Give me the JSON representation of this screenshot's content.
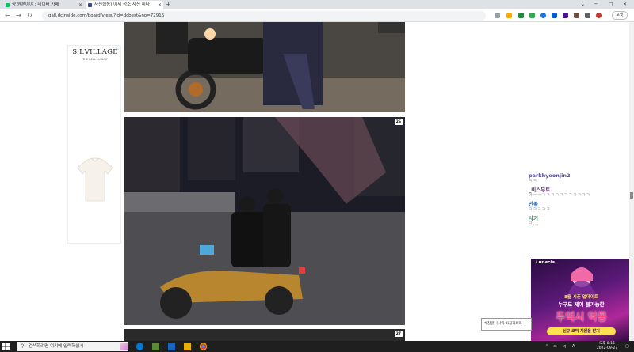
{
  "tabs": [
    {
      "title": "향 원본이야 : 네이버 카페",
      "active": false
    },
    {
      "title": "사진협동) 어제 청소 사진 피타",
      "active": true
    }
  ],
  "window_controls": {
    "minimize": "─",
    "maximize": "□",
    "close": "✕"
  },
  "toolbar": {
    "url": "gall.dcinside.com/board/view/?id=dcbest&no=72916",
    "profile_label": "포맷"
  },
  "ad": {
    "brand": "S.I.VILLAGE",
    "tagline": "THE REAL LUXURY"
  },
  "photos": [
    {
      "number": ""
    },
    {
      "number": "26"
    },
    {
      "number": "27"
    }
  ],
  "comments": [
    {
      "user": "parkhyeonjin2",
      "text": "ㅋㅋ",
      "color": "#5b4a9e"
    },
    {
      "user": "_비스무트",
      "text": "아ㅡㅡㅋㅋㅋㅋㅋㅋㅋㅋㅋㅋㅋ",
      "color": "#6a2e8a"
    },
    {
      "user": "만콜",
      "text": "ㅋㅋㅋㅋㅋ",
      "color": "#2a6ab0"
    },
    {
      "user": "사키__",
      "text": "ㅋ...",
      "color": "#1a8a4a"
    }
  ],
  "banner": {
    "logo": "Lunacia",
    "line1": "8월 시즌 업데이트",
    "line2": "누구도 제어 불가능한",
    "headline": "두억시 악몽",
    "cta": "신규 코믹 지원을 받기"
  },
  "tooltip": "*[참말] [나와 사진카페와...",
  "taskbar": {
    "search_placeholder": "검색하려면 여기에 입력하십시",
    "ime": "A",
    "time": "오후 8:16",
    "date": "2022-09-27"
  }
}
